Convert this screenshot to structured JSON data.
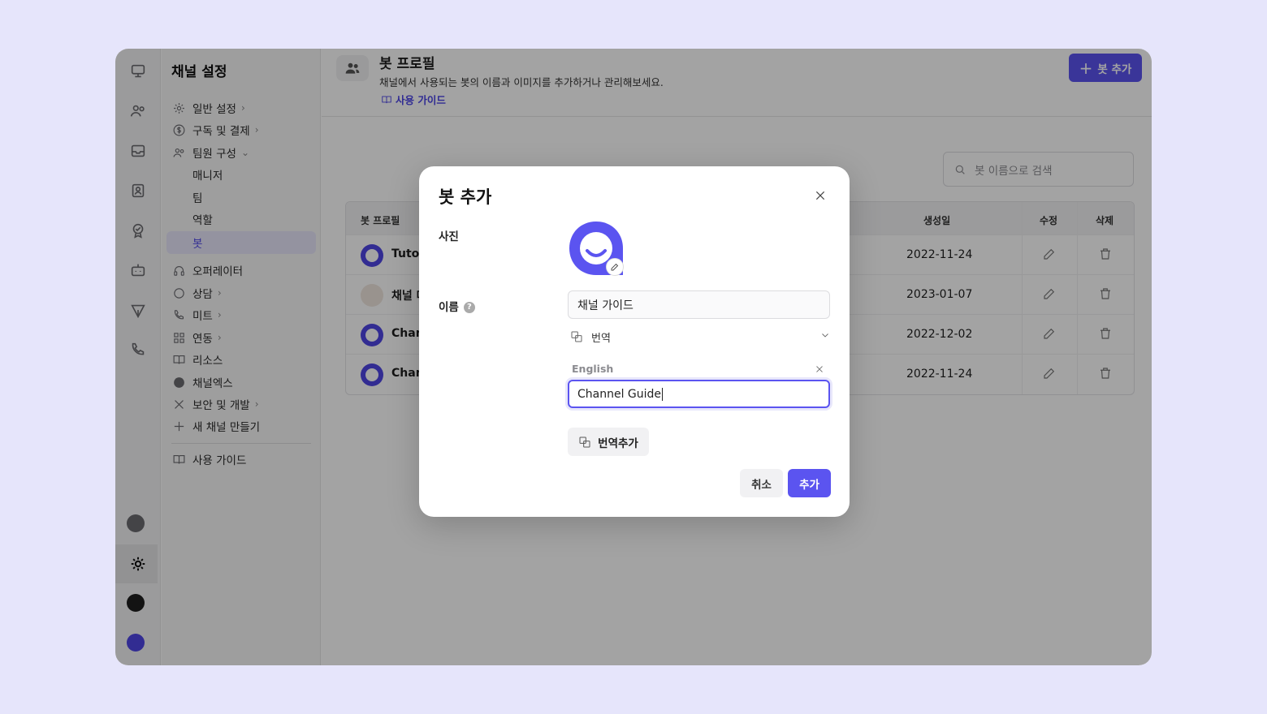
{
  "sidebar": {
    "title": "채널 설정",
    "items": [
      {
        "label": "일반 설정",
        "icon": "gear-icon",
        "chevron": "›"
      },
      {
        "label": "구독 및 결제",
        "icon": "dollar-icon",
        "chevron": "›"
      },
      {
        "label": "팀원 구성",
        "icon": "team-icon",
        "chevron": "⌄"
      },
      {
        "label": "오퍼레이터",
        "icon": "headset-icon",
        "chevron": ""
      },
      {
        "label": "상담",
        "icon": "chat-icon",
        "chevron": "›"
      },
      {
        "label": "미트",
        "icon": "phone-icon",
        "chevron": "›"
      },
      {
        "label": "연동",
        "icon": "grid-icon",
        "chevron": "›"
      },
      {
        "label": "리소스",
        "icon": "book-icon",
        "chevron": ""
      },
      {
        "label": "채널엑스",
        "icon": "channelx-icon",
        "chevron": ""
      },
      {
        "label": "보안 및 개발",
        "icon": "tools-icon",
        "chevron": "›"
      },
      {
        "label": "새 채널 만들기",
        "icon": "plus-icon",
        "chevron": ""
      }
    ],
    "team_sub": [
      "매니저",
      "팀",
      "역할",
      "봇"
    ],
    "guide": "사용 가이드"
  },
  "header": {
    "title": "봇 프로필",
    "description": "채널에서 사용되는 봇의 이름과 이미지를 추가하거나 관리해보세요.",
    "guide_link": "사용 가이드",
    "add_button": "봇 추가"
  },
  "search": {
    "placeholder": "봇 이름으로 검색"
  },
  "table": {
    "headers": {
      "profile": "봇 프로필",
      "created": "생성일",
      "edit": "수정",
      "delete": "삭제"
    },
    "rows": [
      {
        "name": "Tutor",
        "date": "2022-11-24"
      },
      {
        "name": "채널 마",
        "date": "2023-01-07"
      },
      {
        "name": "Chan",
        "date": "2022-12-02"
      },
      {
        "name": "Chan",
        "date": "2022-11-24"
      }
    ]
  },
  "modal": {
    "title": "봇 추가",
    "photo_label": "사진",
    "name_label": "이름",
    "help_glyph": "?",
    "name_value": "채널 가이드",
    "translation_label": "번역",
    "language_label": "English",
    "english_value": "Channel Guide",
    "add_translation": "번역추가",
    "cancel": "취소",
    "confirm": "추가"
  },
  "colors": {
    "accent": "#5b54f0",
    "brand": "#4f46e5"
  }
}
